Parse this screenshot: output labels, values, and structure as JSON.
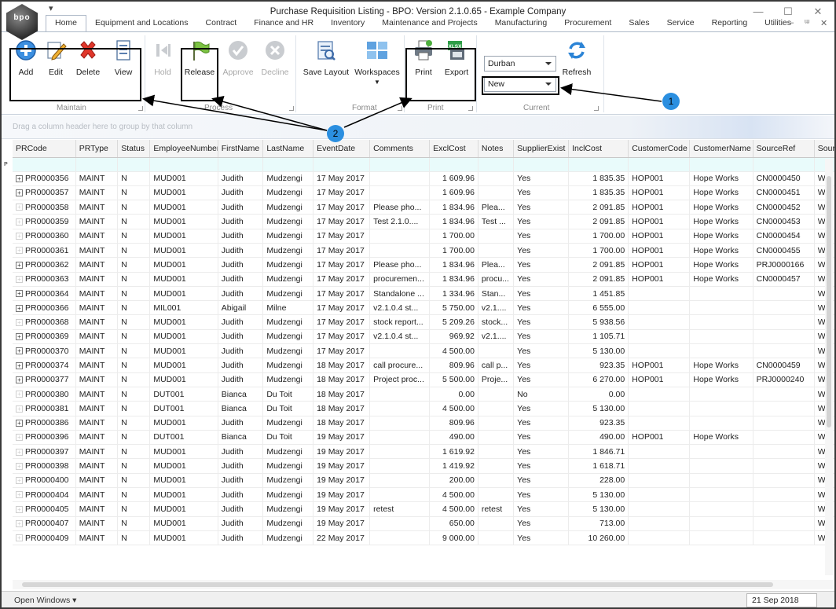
{
  "window": {
    "title": "Purchase Requisition Listing - BPO: Version 2.1.0.65 - Example Company",
    "logo_text": "bpo",
    "qat_symbol": "▾",
    "controls": {
      "minimize": "—",
      "maximize": "☐",
      "close": "✕"
    },
    "mdi_controls": {
      "minimize": "–",
      "restore": "ᵚ",
      "close": "✕"
    }
  },
  "tabs": [
    "Home",
    "Equipment and Locations",
    "Contract",
    "Finance and HR",
    "Inventory",
    "Maintenance and Projects",
    "Manufacturing",
    "Procurement",
    "Sales",
    "Service",
    "Reporting",
    "Utilities"
  ],
  "ribbon": {
    "maintain": {
      "label": "Maintain",
      "add": "Add",
      "edit": "Edit",
      "delete": "Delete",
      "view": "View"
    },
    "process": {
      "label": "Process",
      "hold": "Hold",
      "release": "Release",
      "approve": "Approve",
      "decline": "Decline"
    },
    "format": {
      "label": "Format",
      "save_layout": "Save Layout",
      "workspaces": "Workspaces"
    },
    "print": {
      "label": "Print",
      "print": "Print",
      "export": "Export",
      "export_badge": "XLSX"
    },
    "current": {
      "label": "Current",
      "site": "Durban",
      "status": "New",
      "refresh": "Refresh"
    }
  },
  "annotations": {
    "badge1": "1",
    "badge2": "2"
  },
  "group_panel_hint": "Drag a column header here to group by that column",
  "grid": {
    "columns": [
      "PRCode",
      "PRType",
      "Status",
      "EmployeeNumber",
      "FirstName",
      "LastName",
      "EventDate",
      "Comments",
      "ExclCost",
      "Notes",
      "SupplierExist",
      "InclCost",
      "CustomerCode",
      "CustomerName",
      "SourceRef",
      "SourceT"
    ],
    "filter_icon": "ᴘ",
    "rows": [
      {
        "code": "PR0000356",
        "plus": true,
        "type": "MAINT",
        "status": "N",
        "emp": "MUD001",
        "first": "Judith",
        "last": "Mudzengi",
        "date": "17 May 2017",
        "comments": "",
        "excl": "1 609.96",
        "notes": "",
        "supp": "Yes",
        "incl": "1 835.35",
        "cust": "HOP001",
        "custname": "Hope Works",
        "src": "CN0000450",
        "srct": "War"
      },
      {
        "code": "PR0000357",
        "plus": true,
        "type": "MAINT",
        "status": "N",
        "emp": "MUD001",
        "first": "Judith",
        "last": "Mudzengi",
        "date": "17 May 2017",
        "comments": "",
        "excl": "1 609.96",
        "notes": "",
        "supp": "Yes",
        "incl": "1 835.35",
        "cust": "HOP001",
        "custname": "Hope Works",
        "src": "CN0000451",
        "srct": "War"
      },
      {
        "code": "PR0000358",
        "plus": false,
        "type": "MAINT",
        "status": "N",
        "emp": "MUD001",
        "first": "Judith",
        "last": "Mudzengi",
        "date": "17 May 2017",
        "comments": "Please pho...",
        "excl": "1 834.96",
        "notes": "Plea...",
        "supp": "Yes",
        "incl": "2 091.85",
        "cust": "HOP001",
        "custname": "Hope Works",
        "src": "CN0000452",
        "srct": "War"
      },
      {
        "code": "PR0000359",
        "plus": false,
        "type": "MAINT",
        "status": "N",
        "emp": "MUD001",
        "first": "Judith",
        "last": "Mudzengi",
        "date": "17 May 2017",
        "comments": "Test 2.1.0....",
        "excl": "1 834.96",
        "notes": "Test ...",
        "supp": "Yes",
        "incl": "2 091.85",
        "cust": "HOP001",
        "custname": "Hope Works",
        "src": "CN0000453",
        "srct": "War"
      },
      {
        "code": "PR0000360",
        "plus": false,
        "type": "MAINT",
        "status": "N",
        "emp": "MUD001",
        "first": "Judith",
        "last": "Mudzengi",
        "date": "17 May 2017",
        "comments": "",
        "excl": "1 700.00",
        "notes": "",
        "supp": "Yes",
        "incl": "1 700.00",
        "cust": "HOP001",
        "custname": "Hope Works",
        "src": "CN0000454",
        "srct": "War"
      },
      {
        "code": "PR0000361",
        "plus": false,
        "type": "MAINT",
        "status": "N",
        "emp": "MUD001",
        "first": "Judith",
        "last": "Mudzengi",
        "date": "17 May 2017",
        "comments": "",
        "excl": "1 700.00",
        "notes": "",
        "supp": "Yes",
        "incl": "1 700.00",
        "cust": "HOP001",
        "custname": "Hope Works",
        "src": "CN0000455",
        "srct": "War"
      },
      {
        "code": "PR0000362",
        "plus": true,
        "type": "MAINT",
        "status": "N",
        "emp": "MUD001",
        "first": "Judith",
        "last": "Mudzengi",
        "date": "17 May 2017",
        "comments": "Please pho...",
        "excl": "1 834.96",
        "notes": "Plea...",
        "supp": "Yes",
        "incl": "2 091.85",
        "cust": "HOP001",
        "custname": "Hope Works",
        "src": "PRJ0000166",
        "srct": "War"
      },
      {
        "code": "PR0000363",
        "plus": false,
        "type": "MAINT",
        "status": "N",
        "emp": "MUD001",
        "first": "Judith",
        "last": "Mudzengi",
        "date": "17 May 2017",
        "comments": "procuremen...",
        "excl": "1 834.96",
        "notes": "procu...",
        "supp": "Yes",
        "incl": "2 091.85",
        "cust": "HOP001",
        "custname": "Hope Works",
        "src": "CN0000457",
        "srct": "War"
      },
      {
        "code": "PR0000364",
        "plus": true,
        "type": "MAINT",
        "status": "N",
        "emp": "MUD001",
        "first": "Judith",
        "last": "Mudzengi",
        "date": "17 May 2017",
        "comments": "Standalone ...",
        "excl": "1 334.96",
        "notes": "Stan...",
        "supp": "Yes",
        "incl": "1 451.85",
        "cust": "",
        "custname": "",
        "src": "",
        "srct": "War"
      },
      {
        "code": "PR0000366",
        "plus": true,
        "type": "MAINT",
        "status": "N",
        "emp": "MIL001",
        "first": "Abigail",
        "last": "Milne",
        "date": "17 May 2017",
        "comments": "v2.1.0.4 st...",
        "excl": "5 750.00",
        "notes": "v2.1....",
        "supp": "Yes",
        "incl": "6 555.00",
        "cust": "",
        "custname": "",
        "src": "",
        "srct": "War"
      },
      {
        "code": "PR0000368",
        "plus": false,
        "type": "MAINT",
        "status": "N",
        "emp": "MUD001",
        "first": "Judith",
        "last": "Mudzengi",
        "date": "17 May 2017",
        "comments": "stock report...",
        "excl": "5 209.26",
        "notes": "stock...",
        "supp": "Yes",
        "incl": "5 938.56",
        "cust": "",
        "custname": "",
        "src": "",
        "srct": "War"
      },
      {
        "code": "PR0000369",
        "plus": true,
        "type": "MAINT",
        "status": "N",
        "emp": "MUD001",
        "first": "Judith",
        "last": "Mudzengi",
        "date": "17 May 2017",
        "comments": "v2.1.0.4 st...",
        "excl": "969.92",
        "notes": "v2.1....",
        "supp": "Yes",
        "incl": "1 105.71",
        "cust": "",
        "custname": "",
        "src": "",
        "srct": "War"
      },
      {
        "code": "PR0000370",
        "plus": true,
        "type": "MAINT",
        "status": "N",
        "emp": "MUD001",
        "first": "Judith",
        "last": "Mudzengi",
        "date": "17 May 2017",
        "comments": "",
        "excl": "4 500.00",
        "notes": "",
        "supp": "Yes",
        "incl": "5 130.00",
        "cust": "",
        "custname": "",
        "src": "",
        "srct": "War"
      },
      {
        "code": "PR0000374",
        "plus": true,
        "type": "MAINT",
        "status": "N",
        "emp": "MUD001",
        "first": "Judith",
        "last": "Mudzengi",
        "date": "18 May 2017",
        "comments": "call procure...",
        "excl": "809.96",
        "notes": "call p...",
        "supp": "Yes",
        "incl": "923.35",
        "cust": "HOP001",
        "custname": "Hope Works",
        "src": "CN0000459",
        "srct": "War"
      },
      {
        "code": "PR0000377",
        "plus": true,
        "type": "MAINT",
        "status": "N",
        "emp": "MUD001",
        "first": "Judith",
        "last": "Mudzengi",
        "date": "18 May 2017",
        "comments": "Project proc...",
        "excl": "5 500.00",
        "notes": "Proje...",
        "supp": "Yes",
        "incl": "6 270.00",
        "cust": "HOP001",
        "custname": "Hope Works",
        "src": "PRJ0000240",
        "srct": "War"
      },
      {
        "code": "PR0000380",
        "plus": false,
        "type": "MAINT",
        "status": "N",
        "emp": "DUT001",
        "first": "Bianca",
        "last": "Du Toit",
        "date": "18 May 2017",
        "comments": "",
        "excl": "0.00",
        "notes": "",
        "supp": "No",
        "incl": "0.00",
        "cust": "",
        "custname": "",
        "src": "",
        "srct": "War"
      },
      {
        "code": "PR0000381",
        "plus": false,
        "type": "MAINT",
        "status": "N",
        "emp": "DUT001",
        "first": "Bianca",
        "last": "Du Toit",
        "date": "18 May 2017",
        "comments": "",
        "excl": "4 500.00",
        "notes": "",
        "supp": "Yes",
        "incl": "5 130.00",
        "cust": "",
        "custname": "",
        "src": "",
        "srct": "War"
      },
      {
        "code": "PR0000386",
        "plus": true,
        "type": "MAINT",
        "status": "N",
        "emp": "MUD001",
        "first": "Judith",
        "last": "Mudzengi",
        "date": "18 May 2017",
        "comments": "",
        "excl": "809.96",
        "notes": "",
        "supp": "Yes",
        "incl": "923.35",
        "cust": "",
        "custname": "",
        "src": "",
        "srct": "War"
      },
      {
        "code": "PR0000396",
        "plus": false,
        "type": "MAINT",
        "status": "N",
        "emp": "DUT001",
        "first": "Bianca",
        "last": "Du Toit",
        "date": "19 May 2017",
        "comments": "",
        "excl": "490.00",
        "notes": "",
        "supp": "Yes",
        "incl": "490.00",
        "cust": "HOP001",
        "custname": "Hope Works",
        "src": "",
        "srct": "War"
      },
      {
        "code": "PR0000397",
        "plus": false,
        "type": "MAINT",
        "status": "N",
        "emp": "MUD001",
        "first": "Judith",
        "last": "Mudzengi",
        "date": "19 May 2017",
        "comments": "",
        "excl": "1 619.92",
        "notes": "",
        "supp": "Yes",
        "incl": "1 846.71",
        "cust": "",
        "custname": "",
        "src": "",
        "srct": "War"
      },
      {
        "code": "PR0000398",
        "plus": false,
        "type": "MAINT",
        "status": "N",
        "emp": "MUD001",
        "first": "Judith",
        "last": "Mudzengi",
        "date": "19 May 2017",
        "comments": "",
        "excl": "1 419.92",
        "notes": "",
        "supp": "Yes",
        "incl": "1 618.71",
        "cust": "",
        "custname": "",
        "src": "",
        "srct": "War"
      },
      {
        "code": "PR0000400",
        "plus": false,
        "type": "MAINT",
        "status": "N",
        "emp": "MUD001",
        "first": "Judith",
        "last": "Mudzengi",
        "date": "19 May 2017",
        "comments": "",
        "excl": "200.00",
        "notes": "",
        "supp": "Yes",
        "incl": "228.00",
        "cust": "",
        "custname": "",
        "src": "",
        "srct": "War"
      },
      {
        "code": "PR0000404",
        "plus": false,
        "type": "MAINT",
        "status": "N",
        "emp": "MUD001",
        "first": "Judith",
        "last": "Mudzengi",
        "date": "19 May 2017",
        "comments": "",
        "excl": "4 500.00",
        "notes": "",
        "supp": "Yes",
        "incl": "5 130.00",
        "cust": "",
        "custname": "",
        "src": "",
        "srct": "War"
      },
      {
        "code": "PR0000405",
        "plus": false,
        "type": "MAINT",
        "status": "N",
        "emp": "MUD001",
        "first": "Judith",
        "last": "Mudzengi",
        "date": "19 May 2017",
        "comments": "retest",
        "excl": "4 500.00",
        "notes": "retest",
        "supp": "Yes",
        "incl": "5 130.00",
        "cust": "",
        "custname": "",
        "src": "",
        "srct": "War"
      },
      {
        "code": "PR0000407",
        "plus": false,
        "type": "MAINT",
        "status": "N",
        "emp": "MUD001",
        "first": "Judith",
        "last": "Mudzengi",
        "date": "19 May 2017",
        "comments": "",
        "excl": "650.00",
        "notes": "",
        "supp": "Yes",
        "incl": "713.00",
        "cust": "",
        "custname": "",
        "src": "",
        "srct": "War"
      },
      {
        "code": "PR0000409",
        "plus": false,
        "type": "MAINT",
        "status": "N",
        "emp": "MUD001",
        "first": "Judith",
        "last": "Mudzengi",
        "date": "22 May 2017",
        "comments": "",
        "excl": "9 000.00",
        "notes": "",
        "supp": "Yes",
        "incl": "10 260.00",
        "cust": "",
        "custname": "",
        "src": "",
        "srct": "War"
      }
    ]
  },
  "statusbar": {
    "open_windows": "Open Windows ▾",
    "date": "21 Sep 2018"
  }
}
